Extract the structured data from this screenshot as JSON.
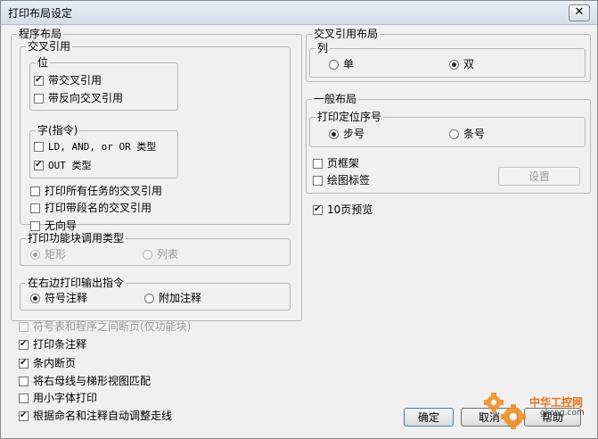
{
  "window": {
    "title": "打印布局设定",
    "close_glyph": "✕"
  },
  "program_layout": {
    "legend": "程序布局",
    "cross_ref": {
      "legend": "交叉引用",
      "bit": {
        "legend": "位",
        "items": [
          {
            "label": "带交叉引用",
            "checked": true
          },
          {
            "label": "带反向交叉引用",
            "checked": false
          }
        ]
      },
      "word": {
        "legend": "字(指令)",
        "items": [
          {
            "label": "LD, AND, or OR 类型",
            "checked": false
          },
          {
            "label": "OUT 类型",
            "checked": true
          }
        ]
      },
      "options": [
        {
          "label": "打印所有任务的交叉引用",
          "checked": false
        },
        {
          "label": "打印带段名的交叉引用",
          "checked": false
        },
        {
          "label": "无向导",
          "checked": false
        }
      ]
    },
    "fb_call_type": {
      "legend": "打印功能块调用类型",
      "rect": "矩形",
      "table": "列表"
    },
    "right_edge": {
      "legend": "在右边打印输出指令",
      "symbol_comment": "符号注释",
      "extra_comment": "附加注释"
    },
    "bottom_options": [
      {
        "label": "符号表和程序之间断页(仅功能块)",
        "checked": false,
        "disabled": true
      },
      {
        "label": "打印条注释",
        "checked": true,
        "disabled": false
      },
      {
        "label": "条内断页",
        "checked": true,
        "disabled": false
      },
      {
        "label": "将右母线与梯形视图匹配",
        "checked": false,
        "disabled": false
      },
      {
        "label": "用小字体打印",
        "checked": false,
        "disabled": false
      },
      {
        "label": "根据命名和注释自动调整走线",
        "checked": true,
        "disabled": false
      }
    ]
  },
  "xref_layout": {
    "legend": "交叉引用布局",
    "column": {
      "legend": "列",
      "single": "单",
      "double": "双"
    }
  },
  "general_layout": {
    "legend": "一般布局",
    "position_number": {
      "legend": "打印定位序号",
      "step": "步号",
      "rung": "条号"
    },
    "page_frame": "页框架",
    "drawing_tag": "绘图标签",
    "settings_button": "设置"
  },
  "preview_10": {
    "label": "10页预览",
    "checked": true
  },
  "footer": {
    "ok": "确定",
    "cancel": "取消",
    "help": "帮助"
  },
  "watermark": {
    "text": "中华工控网",
    "url": "gkong.com"
  },
  "colors": {
    "title_bar": "#dde4ef",
    "dialog_bg": "#f0f0f0",
    "watermark_orange": "#f08a1c"
  }
}
